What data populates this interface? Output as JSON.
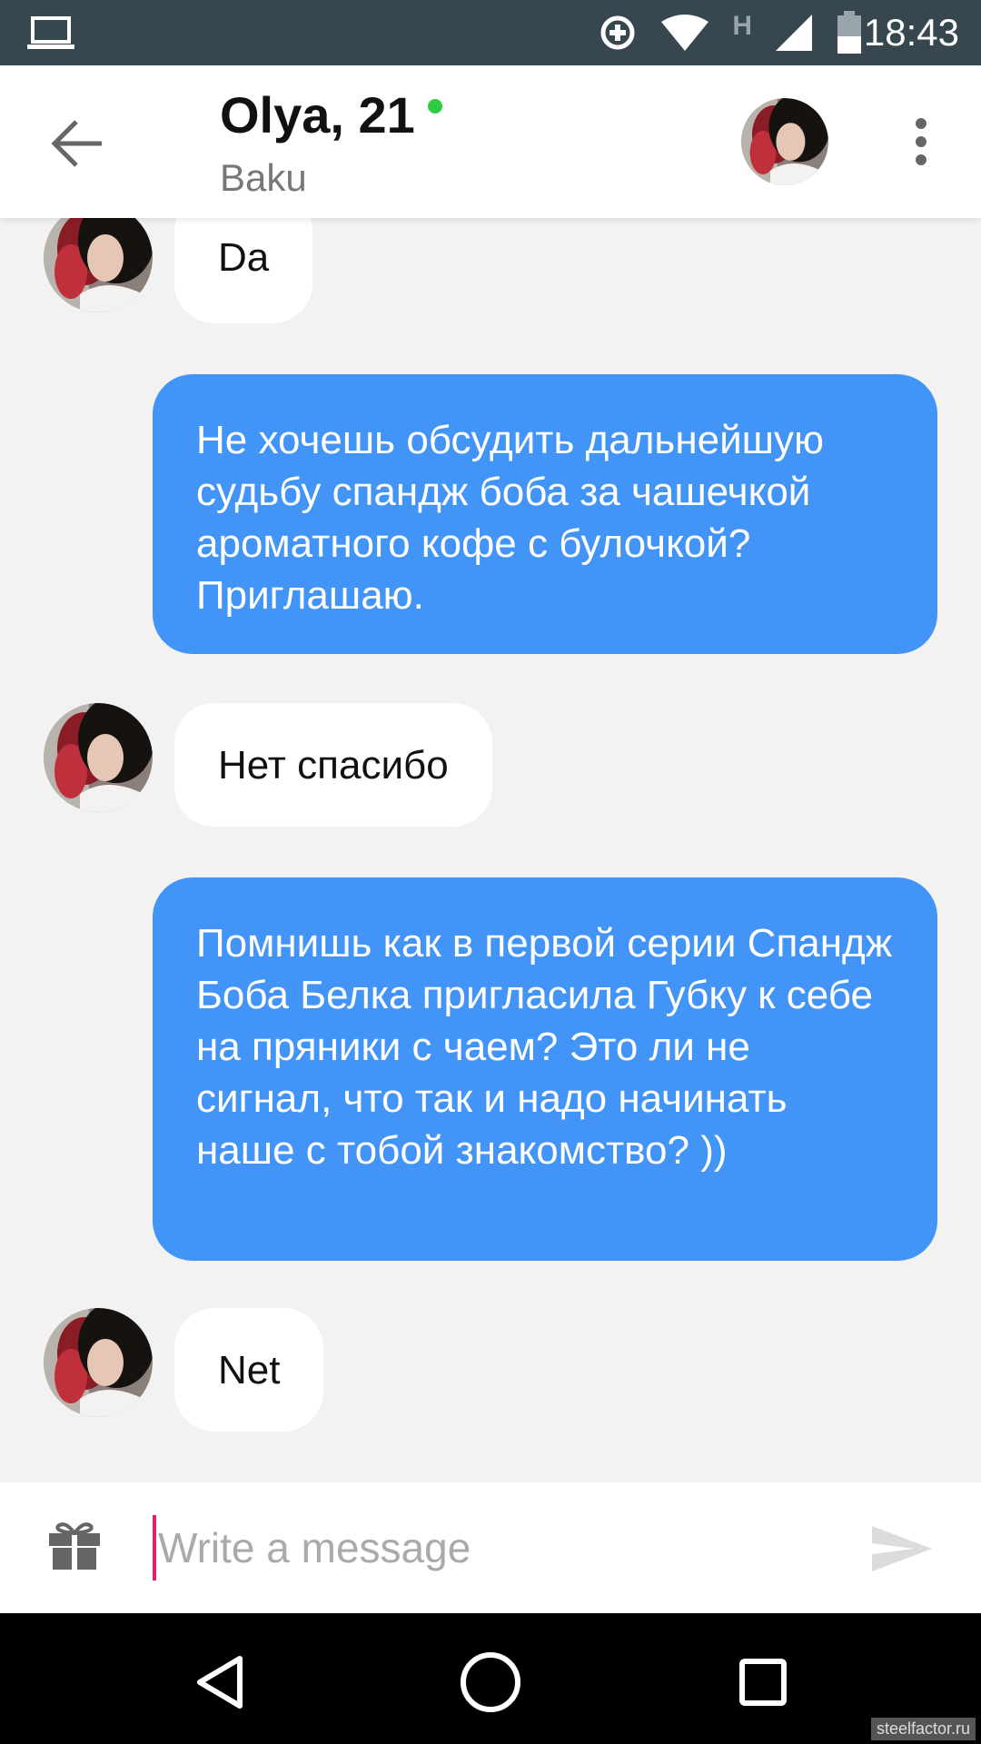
{
  "status_bar": {
    "time": "18:43",
    "network_label": "H",
    "icons": [
      "laptop-icon",
      "data-saver-icon",
      "wifi-icon",
      "cell-signal-icon",
      "battery-icon"
    ]
  },
  "header": {
    "name": "Olya, 21",
    "city": "Baku",
    "online": true,
    "online_color": "#2ecc40",
    "icons": [
      "back-arrow-icon",
      "avatar",
      "more-vert-icon"
    ]
  },
  "messages": [
    {
      "from": "them",
      "text": "Da"
    },
    {
      "from": "me",
      "text": "Не хочешь обсудить дальнейшую судьбу спандж боба за чашечкой ароматного кофе с булочкой? Приглашаю."
    },
    {
      "from": "them",
      "text": "Нет спасибо"
    },
    {
      "from": "me",
      "text": "Помнишь как в первой серии Спандж Боба Белка пригласила Губку к себе на пряники с чаем? Это ли не сигнал, что так и надо начинать наше с тобой знакомство? ))"
    },
    {
      "from": "them",
      "text": "Net"
    }
  ],
  "composer": {
    "placeholder": "Write a message",
    "value": "",
    "icons": [
      "gift-icon",
      "send-icon"
    ]
  },
  "colors": {
    "outgoing_bubble": "#4294f7",
    "incoming_bubble": "#ffffff",
    "chat_background": "#f2f2f2",
    "status_bar": "#37474f",
    "cursor": "#e91e63"
  },
  "nav_bar": {
    "icons": [
      "back-triangle-icon",
      "home-circle-icon",
      "recents-square-icon"
    ]
  },
  "watermark": "steelfactor.ru"
}
